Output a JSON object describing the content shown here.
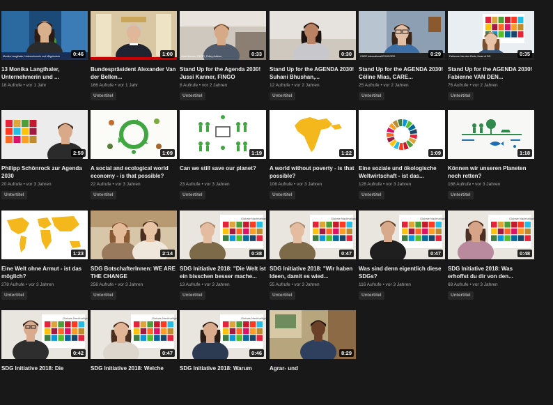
{
  "videos": [
    {
      "title": "13 Monika Langthaler, Unternehmerin und ...",
      "views": "18 Aufrufe",
      "age": "vor 1 Jahr",
      "duration": "0:46",
      "badge": "",
      "thumb": "speaker_interview",
      "overlay": "Monika Langthaler, Unternehmerin und Mitgründerin des Austrian World Summit"
    },
    {
      "title": "Bundespräsident Alexander Van der Bellen...",
      "views": "166 Aufrufe",
      "age": "vor 1 Jahr",
      "duration": "1:00",
      "badge": "Untertitel",
      "thumb": "president"
    },
    {
      "title": "Stand Up for the Agenda 2030! Jussi Kanner, FINGO",
      "views": "8 Aufrufe",
      "age": "vor 2 Jahren",
      "duration": "0:33",
      "badge": "Untertitel",
      "thumb": "speaker_office",
      "overlay": "Jussi Kanner, FINGO, Policy Advisor"
    },
    {
      "title": "Stand Up for the AGENDA 2030! Suhani Bhushan,...",
      "views": "12 Aufrufe",
      "age": "vor 2 Jahren",
      "duration": "0:30",
      "badge": "Untertitel",
      "thumb": "speaker_woman"
    },
    {
      "title": "Stand Up for the AGENDA 2030! Céline Mias, CARE...",
      "views": "25 Aufrufe",
      "age": "vor 2 Jahren",
      "duration": "0:29",
      "badge": "Untertitel",
      "thumb": "speaker_glasses",
      "overlay": "CARE International/CONCORD"
    },
    {
      "title": "Stand Up for the AGENDA 2030! Fabienne VAN DEN...",
      "views": "76 Aufrufe",
      "age": "vor 2 Jahren",
      "duration": "0:35",
      "badge": "Untertitel",
      "thumb": "speaker_sdg",
      "overlay": "Fabienne Van den Eede, Head of DG"
    },
    {
      "title": "Philipp Schönrock zur Agenda 2030",
      "views": "20 Aufrufe",
      "age": "vor 3 Jahren",
      "duration": "2:59",
      "badge": "Untertitel",
      "thumb": "sdg_man"
    },
    {
      "title": "A social and ecological world economy - is that possible?",
      "views": "22 Aufrufe",
      "age": "vor 3 Jahren",
      "duration": "1:09",
      "badge": "Untertitel",
      "thumb": "recycle"
    },
    {
      "title": "Can we still save our planet?",
      "views": "23 Aufrufe",
      "age": "vor 3 Jahren",
      "duration": "1:19",
      "badge": "Untertitel",
      "thumb": "network"
    },
    {
      "title": "A world without poverty - is that possible?",
      "views": "106 Aufrufe",
      "age": "vor 3 Jahren",
      "duration": "1:22",
      "badge": "Untertitel",
      "thumb": "india"
    },
    {
      "title": "Eine soziale und ökologische Weltwirtschaft - ist das...",
      "views": "128 Aufrufe",
      "age": "vor 3 Jahren",
      "duration": "1:09",
      "badge": "Untertitel",
      "thumb": "sdg_wheel"
    },
    {
      "title": "Können wir unseren Planeten noch retten?",
      "views": "168 Aufrufe",
      "age": "vor 3 Jahren",
      "duration": "1:18",
      "badge": "Untertitel",
      "thumb": "nature"
    },
    {
      "title": "Eine Welt ohne Armut - ist das möglich?",
      "views": "278 Aufrufe",
      "age": "vor 3 Jahren",
      "duration": "1:23",
      "badge": "Untertitel",
      "thumb": "world_map"
    },
    {
      "title": "SDG BotschafterInnen: WE ARE THE CHANGE",
      "views": "256 Aufrufe",
      "age": "vor 3 Jahren",
      "duration": "2:14",
      "badge": "Untertitel",
      "thumb": "two_women"
    },
    {
      "title": "SDG Initiative 2018: \"Die Welt ist ein bisschen besser mache...",
      "views": "13 Aufrufe",
      "age": "vor 3 Jahren",
      "duration": "0:38",
      "badge": "Untertitel",
      "thumb": "sdg_board_woman"
    },
    {
      "title": "SDG Initiative 2018: \"Wir haben Ideen, damit es wied...",
      "views": "55 Aufrufe",
      "age": "vor 3 Jahren",
      "duration": "0:47",
      "badge": "Untertitel",
      "thumb": "sdg_board_woman2"
    },
    {
      "title": "Was sind denn eigentlich diese SDGs?",
      "views": "116 Aufrufe",
      "age": "vor 3 Jahren",
      "duration": "0:47",
      "badge": "Untertitel",
      "thumb": "sdg_board_man"
    },
    {
      "title": "SDG Initiative 2018: Was erhoffst du dir von den...",
      "views": "68 Aufrufe",
      "age": "vor 3 Jahren",
      "duration": "0:48",
      "badge": "Untertitel",
      "thumb": "sdg_board_curly"
    },
    {
      "title": "SDG Initiative 2018: Die",
      "views": "",
      "age": "",
      "duration": "0:42",
      "badge": "",
      "thumb": "sdg_board_man_glasses"
    },
    {
      "title": "SDG Initiative 2018: Welche",
      "views": "",
      "age": "",
      "duration": "0:47",
      "badge": "",
      "thumb": "sdg_board_woman3"
    },
    {
      "title": "SDG Initiative 2018: Warum",
      "views": "",
      "age": "",
      "duration": "0:46",
      "badge": "",
      "thumb": "sdg_board_woman4"
    },
    {
      "title": "Agrar- und",
      "views": "",
      "age": "",
      "duration": "8:29",
      "badge": "",
      "thumb": "man_indoor"
    }
  ],
  "meta_separator": "•"
}
